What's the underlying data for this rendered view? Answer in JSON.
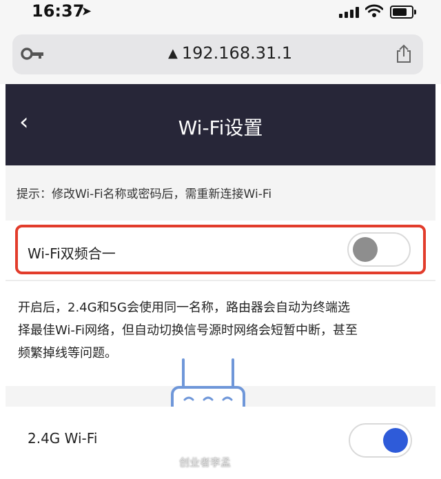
{
  "status_bar": {
    "time": "16:37"
  },
  "browser": {
    "url": "192.168.31.1"
  },
  "nav": {
    "title": "Wi-Fi设置"
  },
  "hint": {
    "text": "提示：修改Wi-Fi名称或密码后，需重新连接Wi-Fi"
  },
  "dual_band": {
    "label": "Wi-Fi双频合一",
    "enabled": false,
    "highlight_color": "#e23c2b"
  },
  "description": {
    "lines": [
      "开启后，2.4G和5G会使用同一名称，路由器会自动为终端选",
      "择最佳Wi-Fi网络，但自动切换信号源时网络会短暂中断，甚至",
      "频繁掉线等问题。"
    ]
  },
  "wifi_24": {
    "label": "2.4G Wi-Fi",
    "enabled": true,
    "accent_color": "#2e5bd9"
  },
  "watermark": {
    "text": "创业者李孟"
  },
  "colors": {
    "nav_background": "#272638",
    "router_icon": "#6f97d9"
  },
  "icons": [
    "location-arrow-icon",
    "signal-icon",
    "wifi-icon",
    "battery-icon",
    "key-icon",
    "warning-icon",
    "share-icon",
    "back-chevron-icon",
    "router-icon"
  ]
}
